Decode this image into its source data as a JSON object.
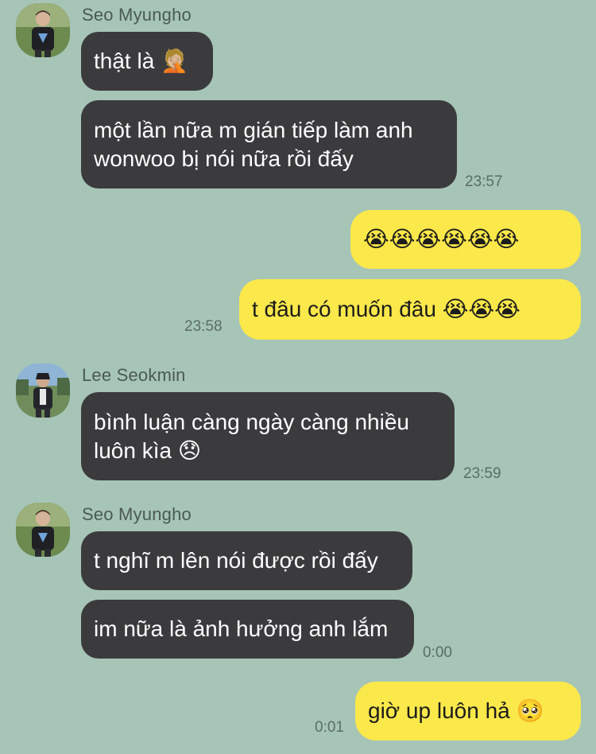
{
  "messages": [
    {
      "sender": "Seo Myungho",
      "text": "thật là 🤦🏼"
    },
    {
      "text": "một lần nữa m gián tiếp làm anh\nwonwoo bị nói nữa rồi đấy",
      "time": "23:57"
    },
    {
      "text": "😭😭😭😭😭😭"
    },
    {
      "text": "t đâu có muốn đâu 😭😭😭",
      "time": "23:58"
    },
    {
      "sender": "Lee Seokmin",
      "text": "bình luận càng ngày càng nhiều\nluôn kìa 😞",
      "time": "23:59"
    },
    {
      "sender": "Seo Myungho",
      "text": "t nghĩ m lên nói được rồi đấy"
    },
    {
      "text": "im nữa là ảnh hưởng anh lắm",
      "time": "0:00"
    },
    {
      "text": "giờ up luôn hả 🥺",
      "time": "0:01"
    }
  ],
  "colors": {
    "background": "#a6c5b7",
    "incoming_bubble": "#3b3b3d",
    "outgoing_bubble": "#fbe84a"
  },
  "icons": {
    "avatar_1": "profile-photo-icon",
    "avatar_2": "profile-photo-icon",
    "avatar_3": "profile-photo-icon"
  }
}
